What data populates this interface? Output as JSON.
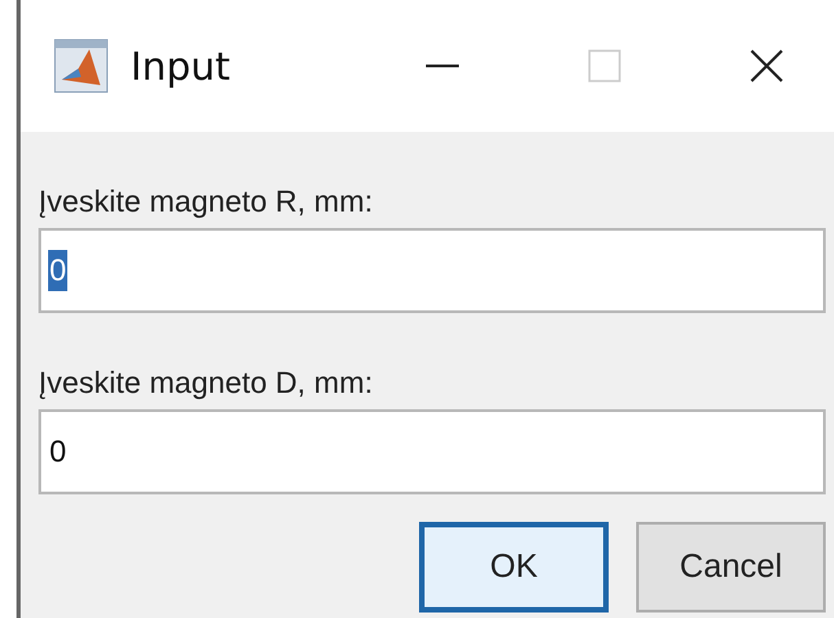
{
  "window": {
    "title": "Input"
  },
  "fields": [
    {
      "label": "Įveskite magneto R, mm:",
      "value": "0",
      "selected": true
    },
    {
      "label": "Įveskite magneto D, mm:",
      "value": "0",
      "selected": false
    }
  ],
  "buttons": [
    {
      "label": "OK",
      "default": true
    },
    {
      "label": "Cancel",
      "default": false
    }
  ]
}
